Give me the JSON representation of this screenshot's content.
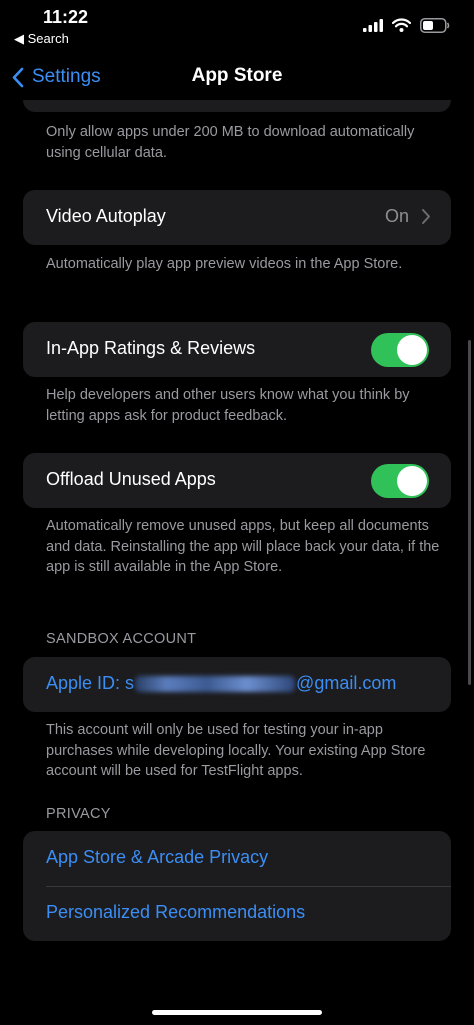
{
  "status_bar": {
    "time": "11:22",
    "back_app": "Search",
    "icons": [
      "cellular-signal",
      "wifi",
      "battery"
    ]
  },
  "nav": {
    "back_label": "Settings",
    "title": "App Store"
  },
  "cellular_footnote": "Only allow apps under 200 MB to download automatically using cellular data.",
  "video_autoplay": {
    "label": "Video Autoplay",
    "value": "On",
    "footnote": "Automatically play app preview videos in the App Store."
  },
  "in_app_ratings": {
    "label": "In-App Ratings & Reviews",
    "enabled": true,
    "footnote": "Help developers and other users know what you think by letting apps ask for product feedback."
  },
  "offload_unused": {
    "label": "Offload Unused Apps",
    "enabled": true,
    "footnote": "Automatically remove unused apps, but keep all documents and data. Reinstalling the app will place back your data, if the app is still available in the App Store."
  },
  "sandbox": {
    "header": "SANDBOX ACCOUNT",
    "apple_id_prefix": "Apple ID: s",
    "apple_id_suffix": "@gmail.com",
    "footnote": "This account will only be used for testing your in-app purchases while developing locally. Your existing App Store account will be used for TestFlight apps."
  },
  "privacy": {
    "header": "PRIVACY",
    "items": [
      {
        "label": "App Store & Arcade Privacy"
      },
      {
        "label": "Personalized Recommendations"
      }
    ]
  },
  "colors": {
    "accent": "#3b8ef5",
    "toggle_on": "#30c158",
    "cell_background": "#1c1c1e",
    "secondary_text": "#9a9aa0"
  }
}
